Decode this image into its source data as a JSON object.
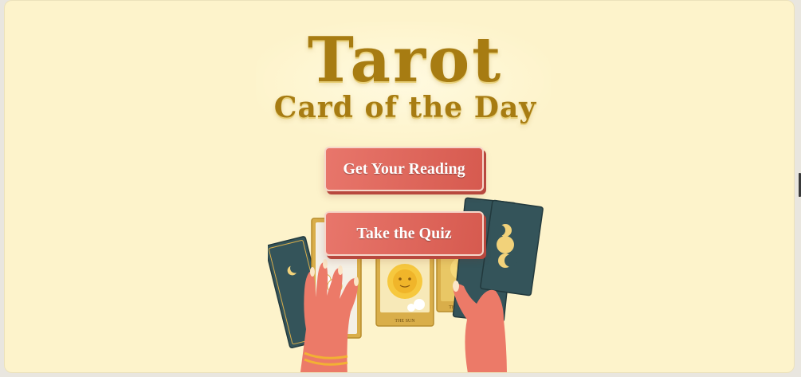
{
  "header": {
    "title": "Tarot",
    "subtitle": "Card of the Day"
  },
  "actions": {
    "reading_label": "Get Your Reading",
    "quiz_label": "Take the Quiz"
  },
  "illustration": {
    "center_card_label": "THE SUN",
    "right_card_label": "THE MOON"
  },
  "colors": {
    "background": "#fdf3cb",
    "title_gold": "#a77c12",
    "button": "#d65a4f",
    "card_dark": "#34545a",
    "card_gold": "#d9ae4a",
    "hand": "#ec7a68"
  }
}
